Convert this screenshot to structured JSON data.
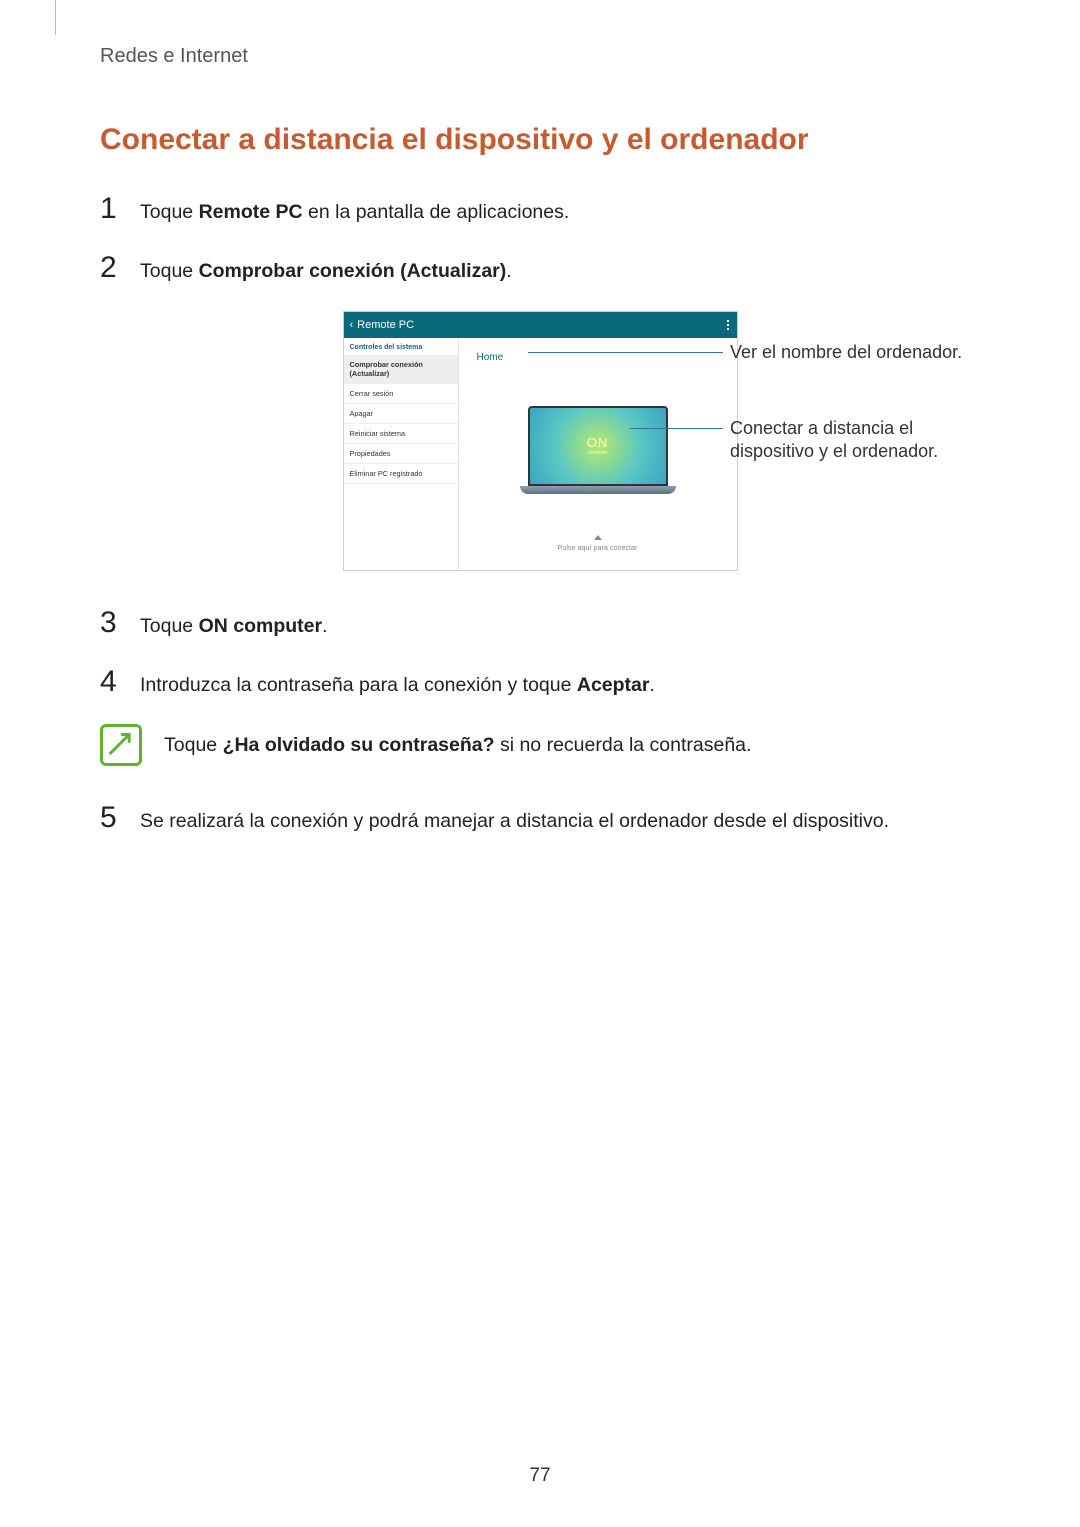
{
  "section_label": "Redes e Internet",
  "section_title": "Conectar a distancia el dispositivo y el ordenador",
  "steps": {
    "s1_num": "1",
    "s1_pre": "Toque ",
    "s1_bold": "Remote PC",
    "s1_post": " en la pantalla de aplicaciones.",
    "s2_num": "2",
    "s2_pre": "Toque ",
    "s2_bold": "Comprobar conexión (Actualizar)",
    "s2_post": ".",
    "s3_num": "3",
    "s3_pre": "Toque ",
    "s3_bold": "ON computer",
    "s3_post": ".",
    "s4_num": "4",
    "s4_pre": "Introduzca la contraseña para la conexión y toque ",
    "s4_bold": "Aceptar",
    "s4_post": ".",
    "s5_num": "5",
    "s5_text": "Se realizará la conexión y podrá manejar a distancia el ordenador desde el dispositivo."
  },
  "note": {
    "pre": "Toque ",
    "bold": "¿Ha olvidado su contraseña?",
    "post": " si no recuerda la contraseña."
  },
  "screenshot": {
    "title_bar": "Remote PC",
    "side_heading": "Controles del sistema",
    "side_items": {
      "comprobar": "Comprobar conexión (Actualizar)",
      "cerrar": "Cerrar sesión",
      "apagar": "Apagar",
      "reiniciar": "Reiniciar sistema",
      "propiedades": "Propiedades",
      "eliminar": "Eliminar PC registrado"
    },
    "home_label": "Home",
    "on_label": "ON",
    "comp_label": "computer",
    "connect_hint": "Pulse aquí para conectar"
  },
  "callouts": {
    "name": "Ver el nombre del ordenador.",
    "connect": "Conectar a distancia el dispositivo y el ordenador."
  },
  "page_number": "77"
}
